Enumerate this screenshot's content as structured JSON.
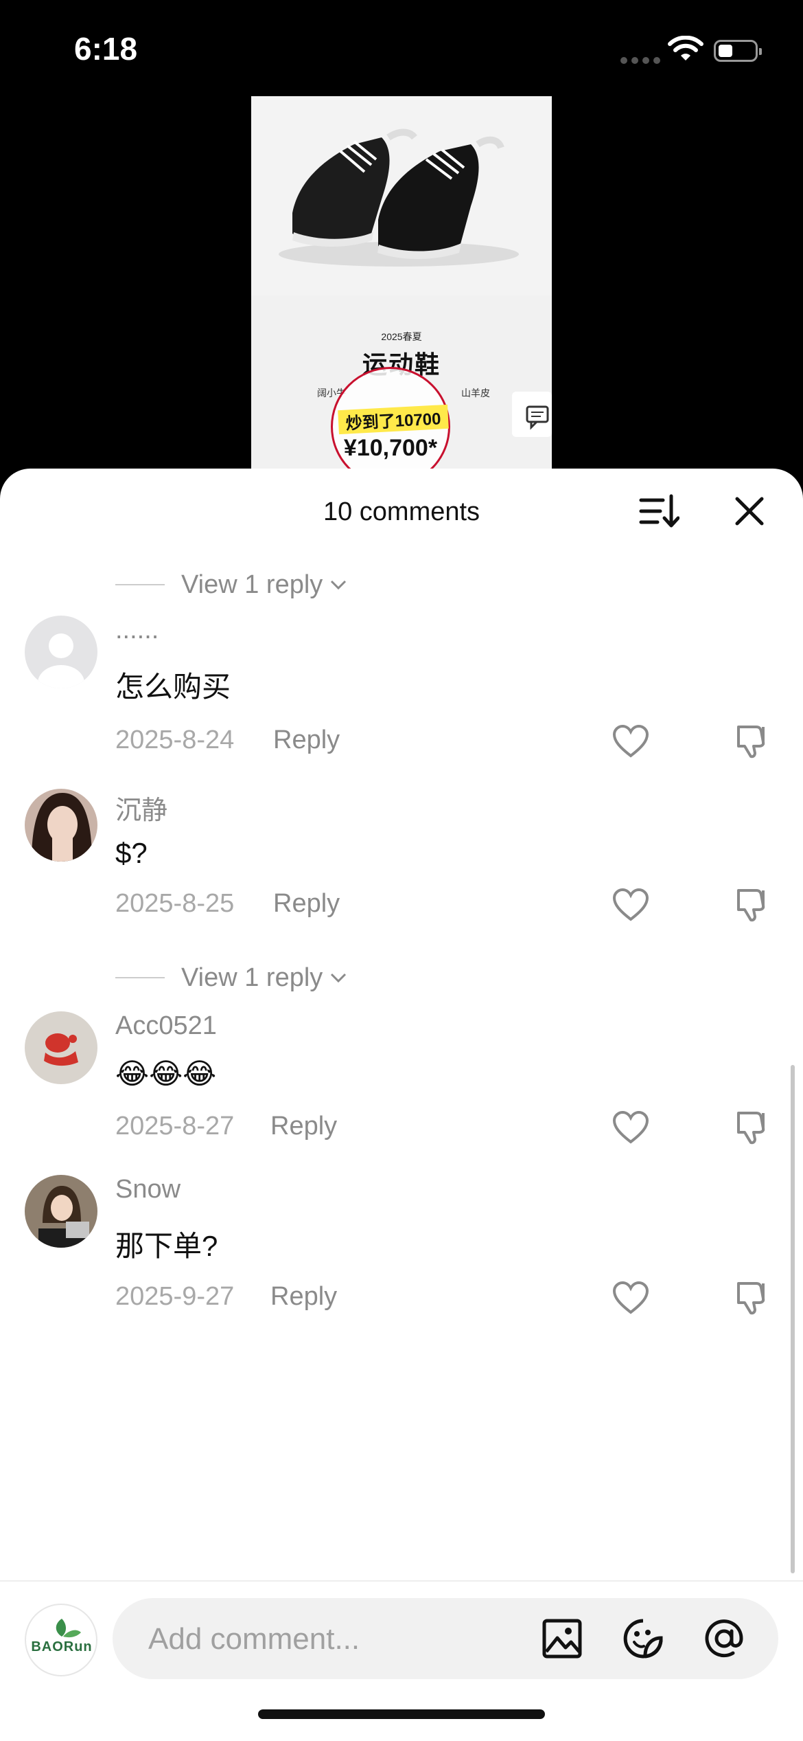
{
  "status_bar": {
    "time": "6:18"
  },
  "video": {
    "season": "2025春夏",
    "product_title": "运动鞋",
    "subtitle_left": "阔小牛",
    "subtitle_right": "山羊皮",
    "hot_label": "炒到了10700",
    "price": "¥10,700*"
  },
  "sheet": {
    "comment_count": "10 comments",
    "view_reply_1": "View 1 reply",
    "view_reply_2": "View 1 reply"
  },
  "comments": [
    {
      "username": "......",
      "text": "怎么购买",
      "date": "2025-8-24",
      "reply_label": "Reply",
      "avatar": "default-avatar"
    },
    {
      "username": "沉静",
      "text": "$?",
      "date": "2025-8-25",
      "reply_label": "Reply",
      "avatar": "user-photo"
    },
    {
      "username": "Acc0521",
      "text": "😂😂😂",
      "date": "2025-8-27",
      "reply_label": "Reply",
      "avatar": "user-photo"
    },
    {
      "username": "Snow",
      "text": "那下单?",
      "date": "2025-9-27",
      "reply_label": "Reply",
      "avatar": "user-photo"
    }
  ],
  "composer": {
    "placeholder": "Add comment...",
    "avatar_logo_text": "BAORun",
    "icons": [
      "image-icon",
      "emoji-sticker-icon",
      "mention-icon"
    ]
  },
  "colors": {
    "sheet_bg": "#ffffff",
    "muted_text": "#8a8a8a",
    "badge_red": "#c8102e",
    "badge_yellow": "#ffe94a"
  }
}
